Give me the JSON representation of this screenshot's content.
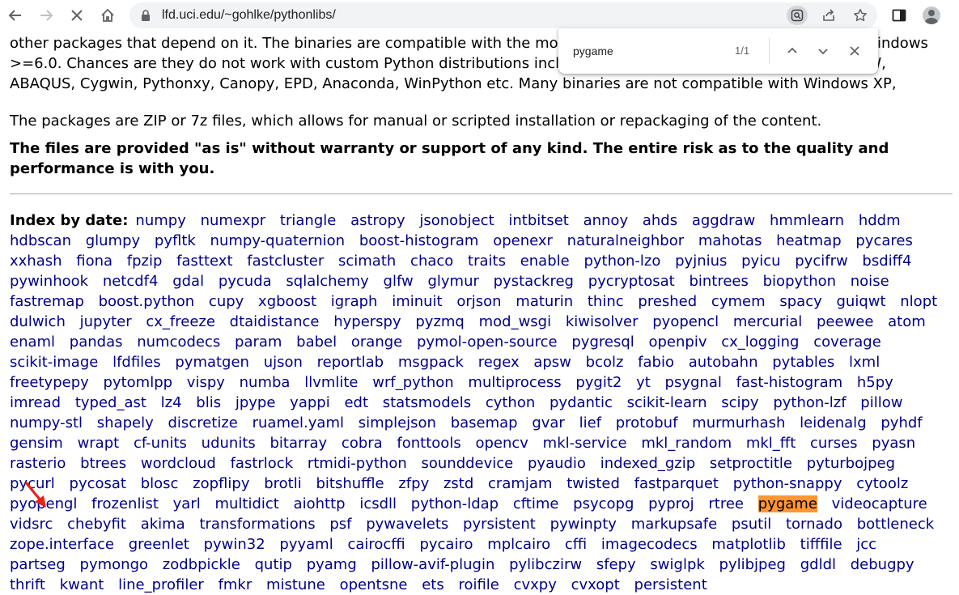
{
  "browser": {
    "url": "lfd.uci.edu/~gohlke/pythonlibs/",
    "icons": [
      "back-icon",
      "forward-icon",
      "stop-loading-icon",
      "home-icon",
      "lock-icon",
      "lens-icon",
      "share-icon",
      "bookmark-star-icon",
      "side-panel-icon",
      "profile-icon"
    ]
  },
  "findbar": {
    "query": "pygame",
    "count": "1/1",
    "colors": {
      "highlight": "#ff9632"
    }
  },
  "page": {
    "paragraph1": "Many binaries depend on numpy+mkl and the current Microsoft Visual C++ Redistributable for Visual Studio 2015-2022 for Python 3, or the Microsoft Visual C++ 2008 Redistributable Package x64, x86, and SP1 for Python 2.7. Install numpy+mkl before other packages that depend on it. The binaries are compatible with the most recent official CPython distributions on Windows >=6.0. Chances are they do not work with custom Python distributions included with Blender, Maya, ArcGIS, OSGeo4W, ABAQUS, Cygwin, Pythonxy, Canopy, EPD, Anaconda, WinPython etc. Many binaries are not compatible with Windows XP, Windows 7, Windows 8, or Wine.",
    "paragraph2": "The packages are ZIP or 7z files, which allows for manual or scripted installation or repackaging of the content.",
    "paragraph3": "The files are provided \"as is\" without warranty or support of any kind. The entire risk as to the quality and performance is with you.",
    "index_label": "Index by date:",
    "link_color": "#00008b",
    "packages": [
      "numpy",
      "numexpr",
      "triangle",
      "astropy",
      "jsonobject",
      "intbitset",
      "annoy",
      "ahds",
      "aggdraw",
      "hmmlearn",
      "hddm",
      "hdbscan",
      "glumpy",
      "pyfltk",
      "numpy-quaternion",
      "boost-histogram",
      "openexr",
      "naturalneighbor",
      "mahotas",
      "heatmap",
      "pycares",
      "xxhash",
      "fiona",
      "fpzip",
      "fasttext",
      "fastcluster",
      "scimath",
      "chaco",
      "traits",
      "enable",
      "python-lzo",
      "pyjnius",
      "pyicu",
      "pycifrw",
      "bsdiff4",
      "pywinhook",
      "netcdf4",
      "gdal",
      "pycuda",
      "sqlalchemy",
      "glfw",
      "glymur",
      "pystackreg",
      "pycryptosat",
      "bintrees",
      "biopython",
      "noise",
      "fastremap",
      "boost.python",
      "cupy",
      "xgboost",
      "igraph",
      "iminuit",
      "orjson",
      "maturin",
      "thinc",
      "preshed",
      "cymem",
      "spacy",
      "guiqwt",
      "nlopt",
      "dulwich",
      "jupyter",
      "cx_freeze",
      "dtaidistance",
      "hyperspy",
      "pyzmq",
      "mod_wsgi",
      "kiwisolver",
      "pyopencl",
      "mercurial",
      "peewee",
      "atom",
      "enaml",
      "pandas",
      "numcodecs",
      "param",
      "babel",
      "orange",
      "pymol-open-source",
      "pygresql",
      "openpiv",
      "cx_logging",
      "coverage",
      "scikit-image",
      "lfdfiles",
      "pymatgen",
      "ujson",
      "reportlab",
      "msgpack",
      "regex",
      "apsw",
      "bcolz",
      "fabio",
      "autobahn",
      "pytables",
      "lxml",
      "freetypepy",
      "pytomlpp",
      "vispy",
      "numba",
      "llvmlite",
      "wrf_python",
      "multiprocess",
      "pygit2",
      "yt",
      "psygnal",
      "fast-histogram",
      "h5py",
      "imread",
      "typed_ast",
      "lz4",
      "blis",
      "jpype",
      "yappi",
      "edt",
      "statsmodels",
      "cython",
      "pydantic",
      "scikit-learn",
      "scipy",
      "python-lzf",
      "pillow",
      "numpy-stl",
      "shapely",
      "discretize",
      "ruamel.yaml",
      "simplejson",
      "basemap",
      "gvar",
      "lief",
      "protobuf",
      "murmurhash",
      "leidenalg",
      "pyhdf",
      "gensim",
      "wrapt",
      "cf-units",
      "udunits",
      "bitarray",
      "cobra",
      "fonttools",
      "opencv",
      "mkl-service",
      "mkl_random",
      "mkl_fft",
      "curses",
      "pyasn",
      "rasterio",
      "btrees",
      "wordcloud",
      "fastrlock",
      "rtmidi-python",
      "sounddevice",
      "pyaudio",
      "indexed_gzip",
      "setproctitle",
      "pyturbojpeg",
      "pycurl",
      "pycosat",
      "blosc",
      "zopflipy",
      "brotli",
      "bitshuffle",
      "zfpy",
      "zstd",
      "cramjam",
      "twisted",
      "fastparquet",
      "python-snappy",
      "cytoolz",
      "pyopengl",
      "frozenlist",
      "yarl",
      "multidict",
      "aiohttp",
      "icsdll",
      "python-ldap",
      "cftime",
      "psycopg",
      "pyproj",
      "rtree",
      "pygame",
      "videocapture",
      "vidsrc",
      "chebyfit",
      "akima",
      "transformations",
      "psf",
      "pywavelets",
      "pyrsistent",
      "pywinpty",
      "markupsafe",
      "psutil",
      "tornado",
      "bottleneck",
      "zope.interface",
      "greenlet",
      "pywin32",
      "pyyaml",
      "cairocffi",
      "pycairo",
      "mplcairo",
      "cffi",
      "imagecodecs",
      "matplotlib",
      "tifffile",
      "jcc",
      "partseg",
      "pymongo",
      "zodbpickle",
      "qutip",
      "pyamg",
      "pillow-avif-plugin",
      "pylibczirw",
      "sfepy",
      "swiglpk",
      "pylibjpeg",
      "gdldl",
      "debugpy",
      "thrift",
      "kwant",
      "line_profiler",
      "fmkr",
      "mistune",
      "opentsne",
      "ets",
      "roifile",
      "cvxpy",
      "cvxopt",
      "persistent"
    ],
    "highlighted_package": "pygame"
  }
}
